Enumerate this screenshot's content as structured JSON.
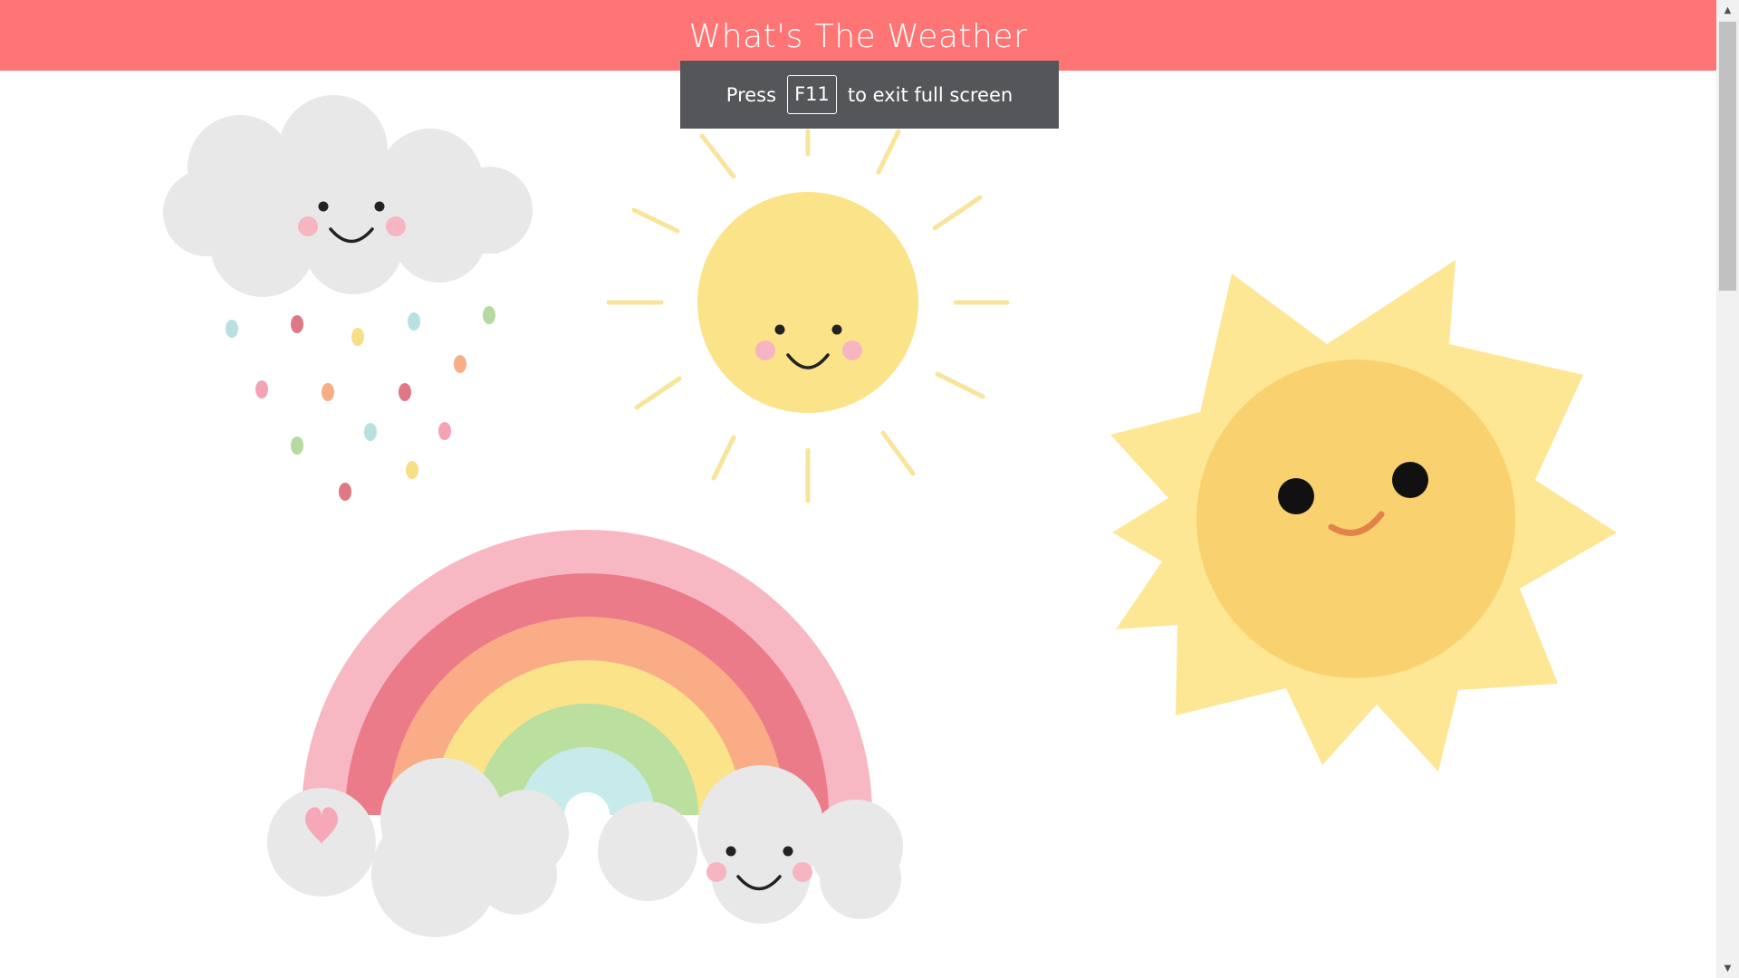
{
  "header": {
    "title": "What's The Weather",
    "background": "#ff7575"
  },
  "fullscreen_notice": {
    "press": "Press",
    "key": "F11",
    "suffix": "to exit full screen"
  },
  "artwork": {
    "items": [
      "rain-cloud-illustration",
      "smiling-sun-illustration",
      "large-sun-illustration",
      "rainbow-illustration"
    ]
  },
  "scrollbar": {
    "up_icon": "▲",
    "down_icon": "▼"
  }
}
